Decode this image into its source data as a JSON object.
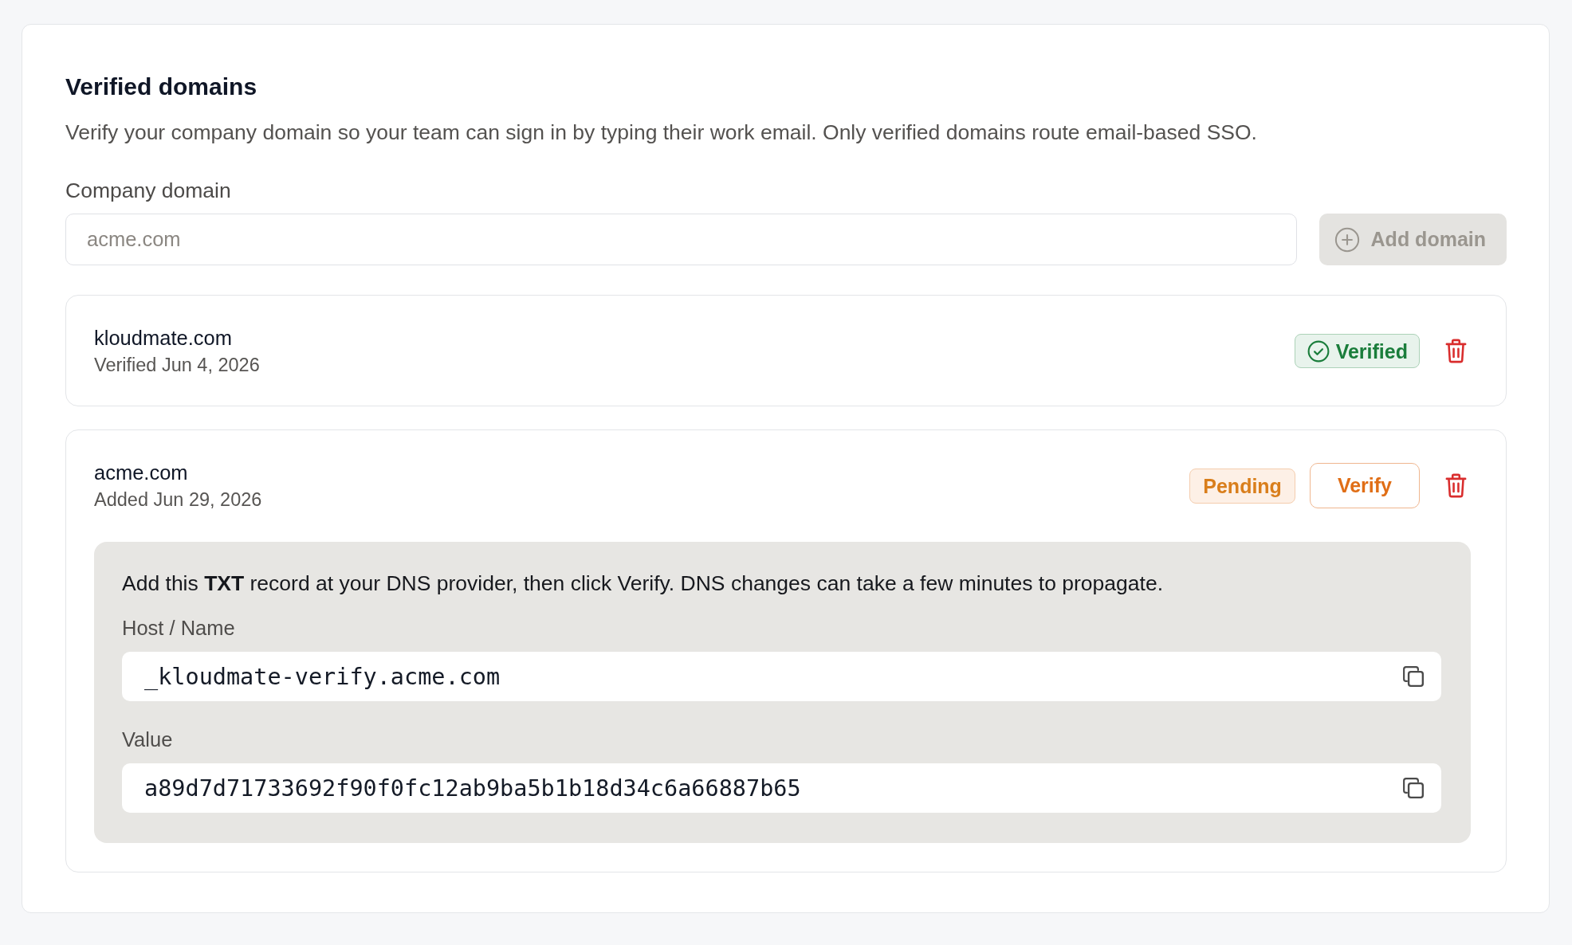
{
  "section": {
    "title": "Verified domains",
    "description": "Verify your company domain so your team can sign in by typing their work email. Only verified domains route email-based SSO."
  },
  "add_form": {
    "label": "Company domain",
    "input": {
      "placeholder": "acme.com"
    },
    "add_button": {
      "label": "Add domain",
      "disabled": true
    }
  },
  "domains": [
    {
      "name": "kloudmate.com",
      "subtitle": "Verified Jun 4, 2026",
      "status": {
        "kind": "verified",
        "label": "Verified"
      }
    },
    {
      "name": "acme.com",
      "subtitle": "Added Jun 29, 2026",
      "status": {
        "kind": "pending",
        "label": "Pending"
      },
      "verify_button": {
        "label": "Verify"
      },
      "dns_record": {
        "instruction": "Add this **TXT** record at your DNS provider, then click Verify. DNS changes can take a few minutes to propagate.",
        "fields": [
          {
            "label": "Host / Name",
            "value": "_kloudmate-verify.acme.com"
          },
          {
            "label": "Value",
            "value": "a89d7d71733692f90f0fc12ab9ba5b1b18d34c6a66887b65"
          }
        ]
      }
    }
  ]
}
